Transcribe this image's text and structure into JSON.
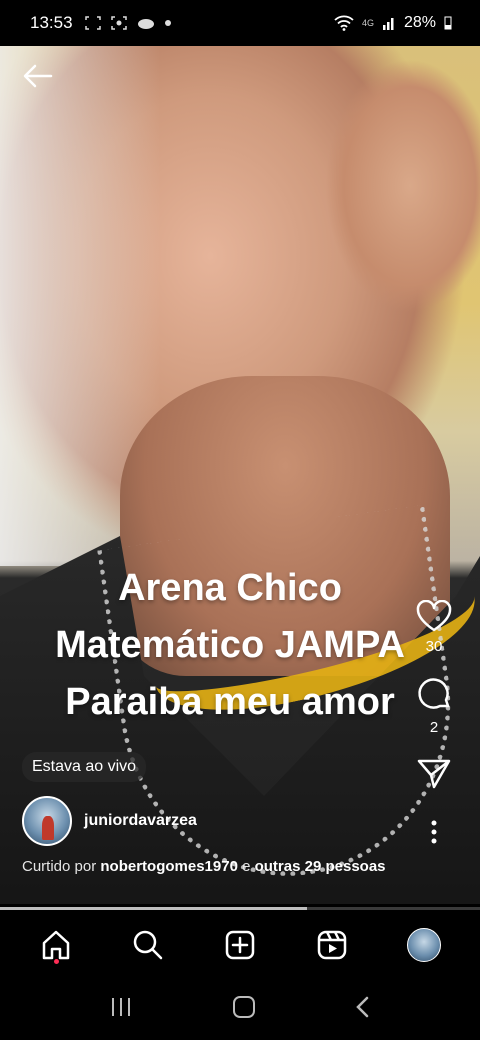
{
  "status_bar": {
    "time": "13:53",
    "network": "4G",
    "battery": "28%"
  },
  "video": {
    "caption_lines": [
      "Arena Chico",
      "Matemático JAMPA",
      "Paraiba meu amor"
    ],
    "progress_fraction": 0.64
  },
  "actions": {
    "likes": "30",
    "comments": "2"
  },
  "live_badge": "Estava ao vivo",
  "author": {
    "username": "juniordavarzea"
  },
  "liked_by": {
    "prefix": "Curtido por",
    "user": "nobertogomes1970",
    "connector": "e",
    "others": "outras 29 pessoas"
  },
  "icons": {
    "back": "arrow-left-icon",
    "like": "heart-icon",
    "comment": "comment-icon",
    "share": "send-icon",
    "more": "more-vertical-icon",
    "home": "home-icon",
    "search": "search-icon",
    "create": "plus-square-icon",
    "reels": "reels-icon"
  },
  "colors": {
    "notification_dot": "#ff2d55",
    "background": "#000000"
  }
}
